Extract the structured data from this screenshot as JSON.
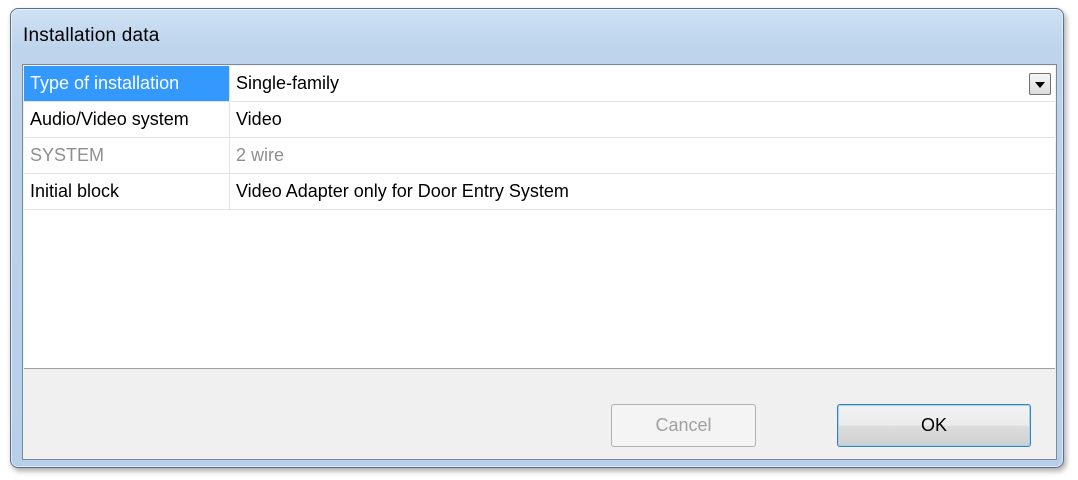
{
  "window": {
    "title": "Installation data"
  },
  "properties": [
    {
      "label": "Type of installation",
      "value": "Single-family",
      "selected": true,
      "disabled": false,
      "has_dropdown": true
    },
    {
      "label": "Audio/Video system",
      "value": "Video",
      "selected": false,
      "disabled": false,
      "has_dropdown": false
    },
    {
      "label": "SYSTEM",
      "value": "2 wire",
      "selected": false,
      "disabled": true,
      "has_dropdown": false
    },
    {
      "label": "Initial block",
      "value": "Video Adapter only for Door Entry System",
      "selected": false,
      "disabled": false,
      "has_dropdown": false
    }
  ],
  "buttons": {
    "cancel_label": "Cancel",
    "cancel_enabled": false,
    "ok_label": "OK"
  },
  "colors": {
    "selection": "#3399ff",
    "disabled_text": "#8f8f8f"
  },
  "icons": {
    "dropdown": "chevron-down-icon"
  }
}
